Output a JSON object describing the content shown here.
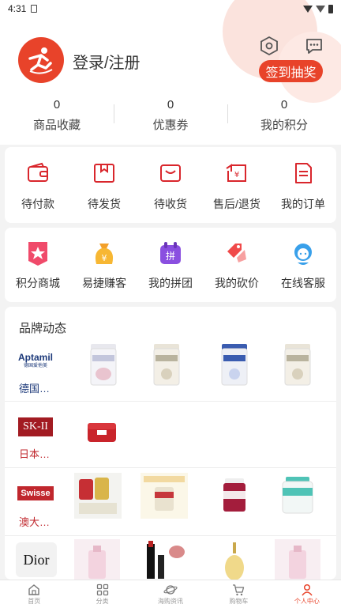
{
  "status_bar": {
    "time": "4:31"
  },
  "profile": {
    "login_label": "登录/注册",
    "lottery_button": "签到抽奖"
  },
  "stats": [
    {
      "value": "0",
      "label": "商品收藏"
    },
    {
      "value": "0",
      "label": "优惠券"
    },
    {
      "value": "0",
      "label": "我的积分"
    }
  ],
  "orders": [
    {
      "label": "待付款",
      "icon": "wallet-icon"
    },
    {
      "label": "待发货",
      "icon": "box-icon"
    },
    {
      "label": "待收货",
      "icon": "receive-icon"
    },
    {
      "label": "售后/退货",
      "icon": "refund-icon"
    },
    {
      "label": "我的订单",
      "icon": "order-list-icon"
    }
  ],
  "services": [
    {
      "label": "积分商城",
      "icon": "points-mall-icon"
    },
    {
      "label": "易捷赚客",
      "icon": "money-bag-icon"
    },
    {
      "label": "我的拼团",
      "icon": "group-buy-icon"
    },
    {
      "label": "我的砍价",
      "icon": "bargain-tag-icon"
    },
    {
      "label": "在线客服",
      "icon": "customer-service-icon"
    }
  ],
  "brands": {
    "title": "品牌动态",
    "rows": [
      {
        "logo_text": "Aptamil",
        "logo_sub": "德国爱他美",
        "name": "德国…"
      },
      {
        "logo_text": "SK-II",
        "name": "日本…"
      },
      {
        "logo_text": "Swisse",
        "name": "澳大…"
      },
      {
        "logo_text": "Dior",
        "name": ""
      }
    ]
  },
  "tabs": [
    {
      "label": "首页",
      "icon": "home-icon"
    },
    {
      "label": "分类",
      "icon": "category-icon"
    },
    {
      "label": "海购资讯",
      "icon": "planet-icon"
    },
    {
      "label": "购物车",
      "icon": "cart-icon"
    },
    {
      "label": "个人中心",
      "icon": "user-icon"
    }
  ],
  "colors": {
    "accent": "#e8432a",
    "brand_red": "#c0272d"
  }
}
